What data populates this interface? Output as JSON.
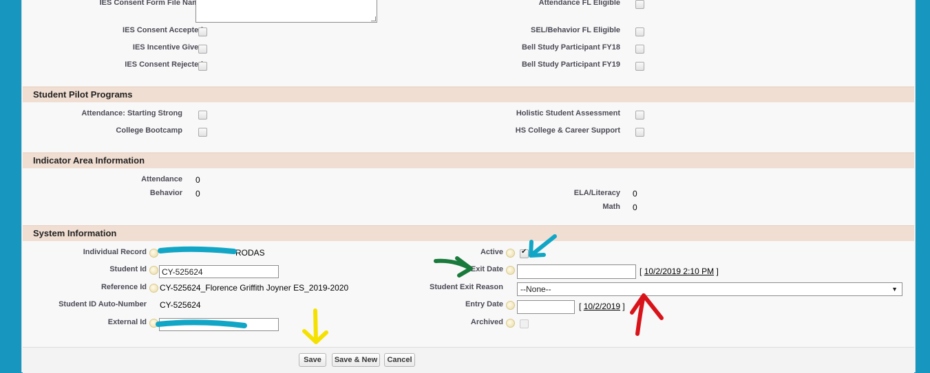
{
  "ies_section": {
    "consent_form_file_label": "IES Consent Form File Name",
    "consent_accepted_label": "IES Consent Accepted",
    "incentive_given_label": "IES Incentive Given",
    "consent_rejected_label": "IES Consent Rejected",
    "attendance_fl_label": "Attendance FL Eligible",
    "sel_behavior_fl_label": "SEL/Behavior FL Eligible",
    "bell_fy18_label": "Bell Study Participant FY18",
    "bell_fy19_label": "Bell Study Participant FY19"
  },
  "pilot_section": {
    "title": "Student Pilot Programs",
    "attendance_strong_label": "Attendance: Starting Strong",
    "college_bootcamp_label": "College Bootcamp",
    "holistic_label": "Holistic Student Assessment",
    "hs_college_label": "HS College & Career Support"
  },
  "indicator_section": {
    "title": "Indicator Area Information",
    "attendance_label": "Attendance",
    "attendance_value": "0",
    "behavior_label": "Behavior",
    "behavior_value": "0",
    "ela_label": "ELA/Literacy",
    "ela_value": "0",
    "math_label": "Math",
    "math_value": "0"
  },
  "system_section": {
    "title": "System Information",
    "individual_record_label": "Individual Record",
    "individual_record_value": "RODAS",
    "student_id_label": "Student Id",
    "student_id_value": "CY-525624",
    "reference_id_label": "Reference Id",
    "reference_id_value": "CY-525624_Florence Griffith Joyner ES_2019-2020",
    "auto_number_label": "Student ID Auto-Number",
    "auto_number_value": "CY-525624",
    "external_id_label": "External Id",
    "active_label": "Active",
    "exit_date_label": "Exit Date",
    "exit_date_link": "10/2/2019 2:10 PM",
    "exit_reason_label": "Student Exit Reason",
    "exit_reason_value": "--None--",
    "entry_date_label": "Entry Date",
    "entry_date_link": "10/2/2019",
    "archived_label": "Archived",
    "bracket_open": "[",
    "bracket_close": "]"
  },
  "footer": {
    "save_label": "Save",
    "save_new_label": "Save & New",
    "cancel_label": "Cancel"
  },
  "annotation_colors": {
    "redaction": "#12a6c6",
    "blue_arrow": "#12a6c6",
    "green_arrow": "#1a7a3c",
    "red_arrow": "#d8141a",
    "yellow_arrow": "#f5e100"
  }
}
